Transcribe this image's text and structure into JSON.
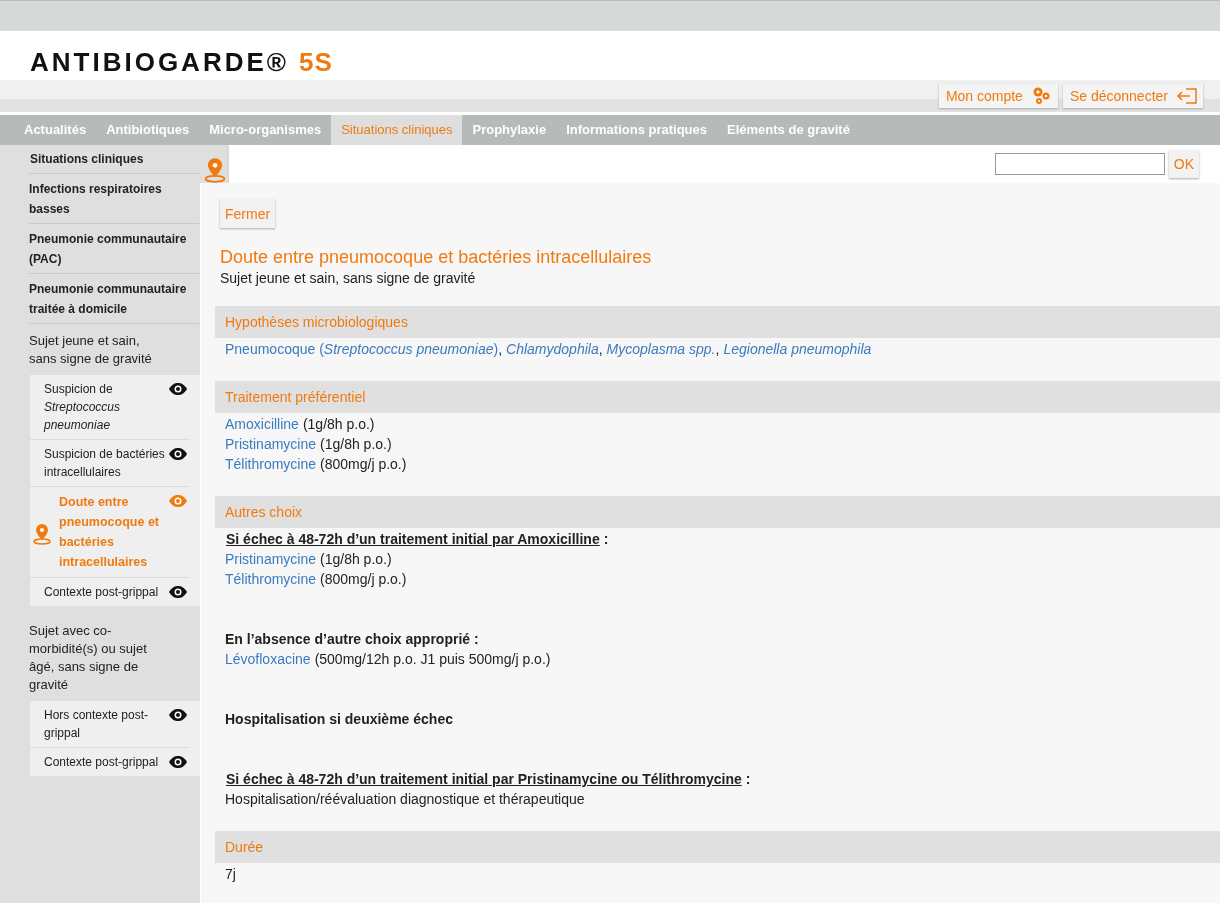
{
  "logo": {
    "name": "ANTIBIOGARDE®",
    "version": "5S"
  },
  "account": [
    {
      "label": "Mon compte",
      "kind": "account"
    },
    {
      "label": "Se déconnecter",
      "kind": "logout"
    }
  ],
  "nav": [
    {
      "label": "Actualités",
      "selected": false
    },
    {
      "label": "Antibiotiques",
      "selected": false
    },
    {
      "label": "Micro-organismes",
      "selected": false
    },
    {
      "label": "Situations cliniques",
      "selected": true
    },
    {
      "label": "Prophylaxie",
      "selected": false
    },
    {
      "label": "Informations pratiques",
      "selected": false
    },
    {
      "label": "Eléments de gravité",
      "selected": false
    }
  ],
  "sidebar": [
    {
      "kind": "heading",
      "label": "Situations cliniques"
    },
    {
      "kind": "bold",
      "label": "Infections respiratoires basses"
    },
    {
      "kind": "bold",
      "label": "Pneumonie communautaire (PAC)"
    },
    {
      "kind": "bold",
      "label": "Pneumonie communautaire traitée à domicile"
    },
    {
      "kind": "group",
      "label": "Sujet jeune et sain, sans signe de gravité",
      "children": [
        {
          "label": "Suspicion de *Streptococcus pneumoniae*",
          "selected": false
        },
        {
          "label": "Suspicion de bactéries intracellulaires",
          "selected": false
        },
        {
          "label": "Doute entre pneumocoque et bactéries intracellulaires",
          "selected": true
        },
        {
          "label": "Contexte post-grippal",
          "selected": false
        }
      ]
    },
    {
      "kind": "group",
      "label": "Sujet avec co-morbidité(s) ou sujet âgé, sans signe de gravité",
      "children": [
        {
          "label": "Hors contexte post-grippal",
          "selected": false
        },
        {
          "label": "Contexte post-grippal",
          "selected": false
        }
      ]
    }
  ],
  "search": {
    "button": "OK"
  },
  "close_button": "Fermer",
  "title": "Doute entre pneumocoque et bactéries intracellulaires",
  "subtitle": "Sujet jeune et sain, sans signe de gravité",
  "sections": [
    {
      "heading": "Hypothèses microbiologiques",
      "items": [
        {
          "kind": "links",
          "parts": [
            {
              "text": "Pneumocoque (*Streptococcus pneumoniae*)",
              "link": true
            },
            {
              "text": ",",
              "link": false
            },
            {
              "text": "*Chlamydophila*",
              "link": true
            },
            {
              "text": ",",
              "link": false
            },
            {
              "text": "*Mycoplasma spp.*",
              "link": true
            },
            {
              "text": ",",
              "link": false
            },
            {
              "text": "*Legionella pneumophila*",
              "link": true
            }
          ]
        }
      ]
    },
    {
      "heading": "Traitement préférentiel",
      "items": [
        {
          "kind": "drug",
          "drug": "Amoxicilline",
          "dose": "(1g/8h p.o.)"
        },
        {
          "kind": "drug",
          "drug": "Pristinamycine",
          "dose": "(1g/8h p.o.)"
        },
        {
          "kind": "drug",
          "drug": "Télithromycine",
          "dose": "(800mg/j p.o.)"
        }
      ]
    },
    {
      "heading": "Autres choix",
      "items": [
        {
          "kind": "condition",
          "text": "Si échec à 48-72h d’un traitement initial par Amoxicilline",
          "suffix": ":"
        },
        {
          "kind": "drug",
          "drug": "Pristinamycine",
          "dose": "(1g/8h p.o.)"
        },
        {
          "kind": "drug",
          "drug": "Télithromycine",
          "dose": "(800mg/j p.o.)"
        },
        {
          "kind": "bold",
          "text": "En l’absence d’autre choix approprié :"
        },
        {
          "kind": "drug",
          "drug": "Lévofloxacine",
          "dose": "(500mg/12h p.o. J1 puis 500mg/j p.o.)"
        },
        {
          "kind": "bold",
          "text": "Hospitalisation si deuxième échec"
        },
        {
          "kind": "condition",
          "text": "Si échec à 48-72h d’un traitement initial par Pristinamycine ou Télithromycine",
          "suffix": ":"
        },
        {
          "kind": "text",
          "text": "Hospitalisation/réévaluation diagnostique et thérapeutique"
        }
      ]
    },
    {
      "heading": "Durée",
      "items": [
        {
          "kind": "text",
          "text": "7j"
        }
      ]
    }
  ]
}
